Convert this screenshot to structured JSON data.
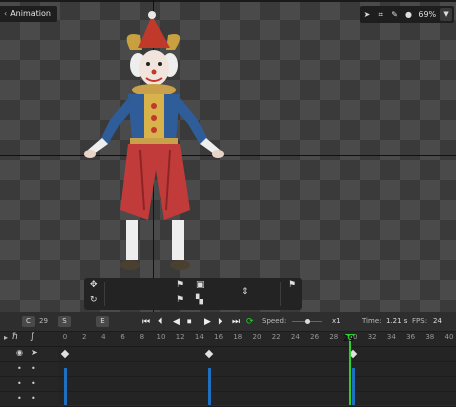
{
  "app": {
    "mode_button": "Animation",
    "zoom": "69%"
  },
  "toolbar_icons": [
    "cursor-icon",
    "crop-icon",
    "brush-icon",
    "paint-icon",
    "dropdown-icon"
  ],
  "context_panel": {
    "icons": [
      "move-icon",
      "rotate-icon",
      "flag-icon",
      "save-icon",
      "bones-icon",
      "flag-icon"
    ]
  },
  "timeline": {
    "c_label": "C",
    "c_value": "29",
    "s_label": "S",
    "e_label": "E",
    "speed_label": "Speed:",
    "speed_value": "x1",
    "time_label": "Time:",
    "time_value": "1.21 s",
    "fps_label": "FPS:",
    "fps_value": "24",
    "current_frame": "29",
    "ruler_ticks": [
      "0",
      "2",
      "4",
      "6",
      "8",
      "10",
      "12",
      "14",
      "16",
      "18",
      "20",
      "22",
      "24",
      "26",
      "28",
      "30",
      "32",
      "34",
      "36",
      "38",
      "40"
    ],
    "keyframes": [
      0,
      15,
      30
    ]
  },
  "colors": {
    "playhead": "#2dd02d",
    "keyframe_line": "#1f6fc0",
    "checker_dark": "#3a3a3a",
    "checker_light": "#4a4a4a"
  }
}
